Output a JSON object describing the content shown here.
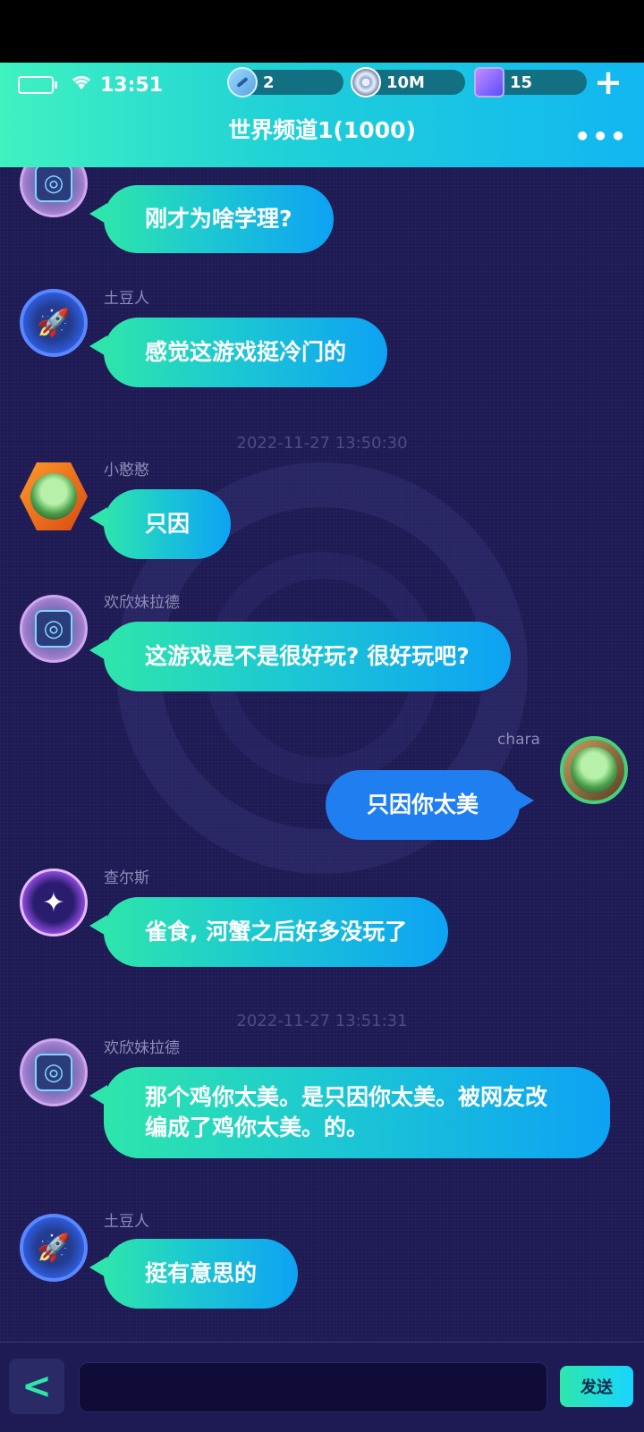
{
  "status_bar": {
    "time": "13:51"
  },
  "resources": [
    {
      "icon": "skateboard-icon",
      "value": "2"
    },
    {
      "icon": "coin-icon",
      "value": "10M"
    },
    {
      "icon": "gem-cube-icon",
      "value": "15"
    }
  ],
  "header": {
    "title": "世界频道1(1000)",
    "more": "•••",
    "add": "+"
  },
  "messages": [
    {
      "user": "",
      "text": "刚才为啥学理?",
      "avatar": "swirl"
    },
    {
      "user": "土豆人",
      "text": "感觉这游戏挺冷门的",
      "avatar": "rocket"
    },
    {
      "timestamp": "2022-11-27 13:50:30"
    },
    {
      "user": "小憨憨",
      "text": "只因",
      "avatar": "girl"
    },
    {
      "user": "欢欣妹拉德",
      "text": "这游戏是不是很好玩? 很好玩吧?",
      "avatar": "swirl"
    },
    {
      "user": "chara",
      "text": "只因你太美",
      "avatar": "girl",
      "mine": true
    },
    {
      "user": "查尔斯",
      "text": "雀食, 河蟹之后好多没玩了",
      "avatar": "eye"
    },
    {
      "timestamp": "2022-11-27 13:51:31"
    },
    {
      "user": "欢欣妹拉德",
      "text": "那个鸡你太美。是只因你太美。被网友改编成了鸡你太美。的。",
      "avatar": "swirl"
    },
    {
      "user": "土豆人",
      "text": "挺有意思的",
      "avatar": "rocket"
    }
  ],
  "footer": {
    "back": "<",
    "input_value": "",
    "send_label": "发送"
  }
}
